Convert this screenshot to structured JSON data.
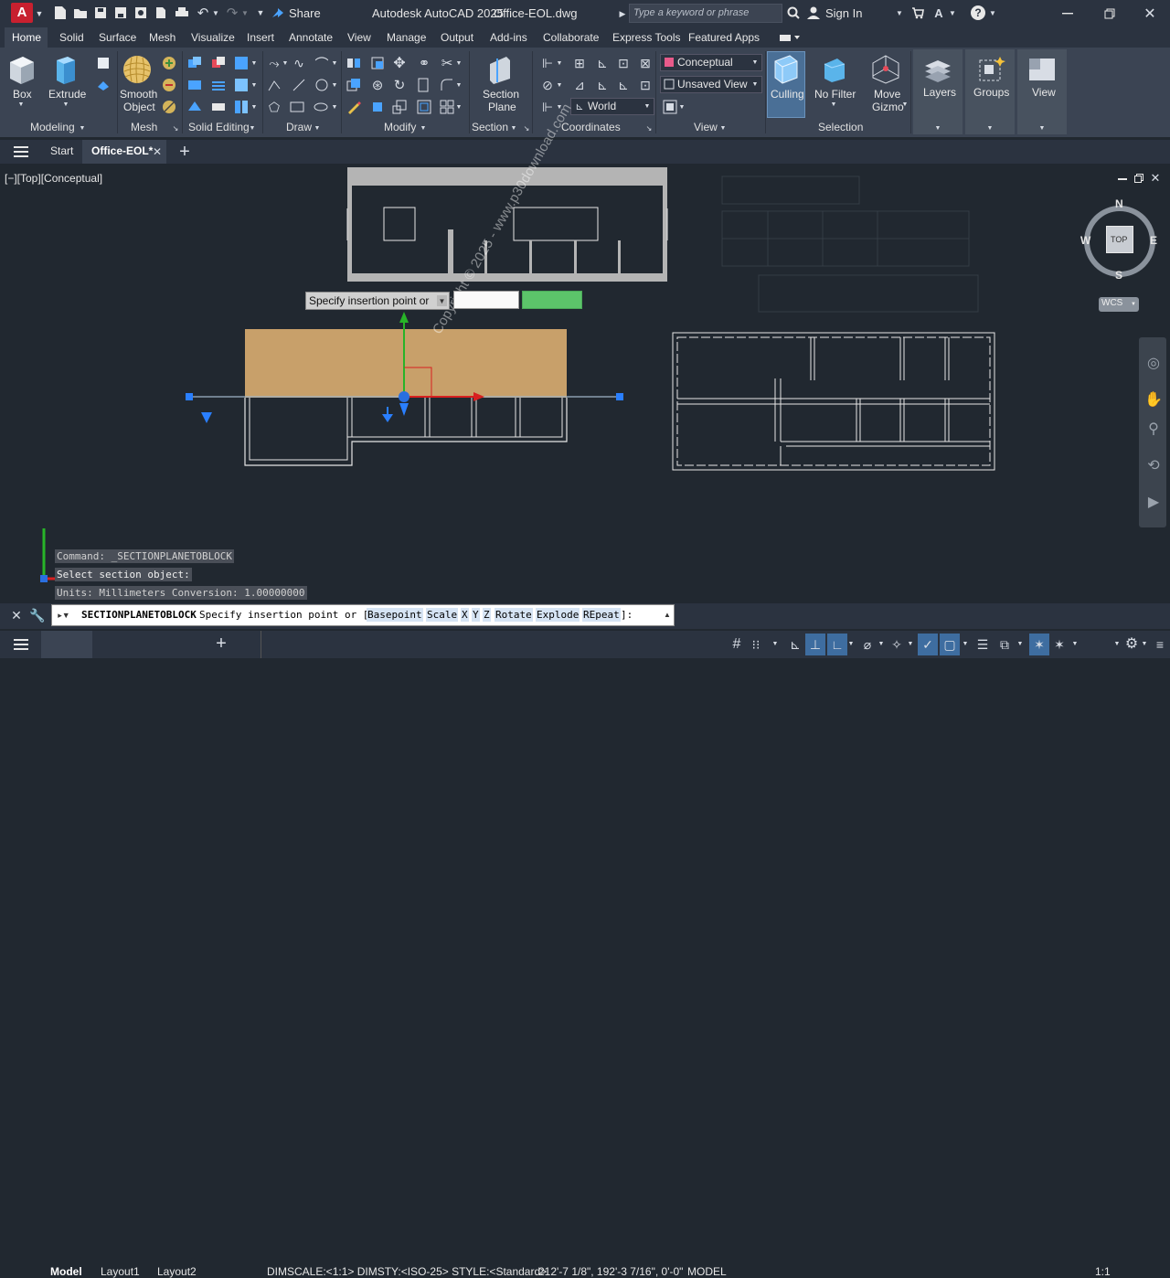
{
  "app": {
    "logo_letter": "A",
    "title": "Autodesk AutoCAD 2025",
    "filename": "Office-EOL.dwg",
    "share_label": "Share",
    "search_placeholder": "Type a keyword or phrase",
    "sign_in": "Sign In"
  },
  "ribbon_tabs": [
    "Home",
    "Solid",
    "Surface",
    "Mesh",
    "Visualize",
    "Insert",
    "Annotate",
    "View",
    "Manage",
    "Output",
    "Add-ins",
    "Collaborate",
    "Express Tools",
    "Featured Apps"
  ],
  "ribbon": {
    "box": "Box",
    "extrude": "Extrude",
    "smooth_object_1": "Smooth",
    "smooth_object_2": "Object",
    "section_plane_1": "Section",
    "section_plane_2": "Plane",
    "visual_style": "Conceptual",
    "view": "Unsaved View",
    "ucs": "World",
    "culling": "Culling",
    "no_filter": "No Filter",
    "move_gizmo_1": "Move",
    "move_gizmo_2": "Gizmo",
    "layers": "Layers",
    "groups": "Groups",
    "view_btn": "View",
    "panels": {
      "modeling": "Modeling",
      "mesh": "Mesh",
      "solid_editing": "Solid Editing",
      "draw": "Draw",
      "modify": "Modify",
      "section": "Section",
      "coordinates": "Coordinates",
      "view": "View",
      "selection": "Selection"
    }
  },
  "doc_tabs": {
    "start": "Start",
    "active": "Office-EOL*"
  },
  "viewport": {
    "label": "[−][Top][Conceptual]",
    "tooltip": "Specify insertion point or",
    "viewcube_top": "TOP",
    "compass_n": "N",
    "compass_s": "S",
    "compass_e": "E",
    "compass_w": "W",
    "wcs": "WCS",
    "watermark": "Copyright © 2025 - www.p30download.com"
  },
  "command_history": [
    "Command: _SECTIONPLANETOBLOCK",
    "Select section object:",
    "Units: Millimeters   Conversion: 1.00000000"
  ],
  "command_line": {
    "command": "SECTIONPLANETOBLOCK",
    "prompt": "Specify insertion point or [",
    "options": [
      "Basepoint",
      "Scale",
      "X",
      "Y",
      "Z",
      "Rotate",
      "Explode",
      "REpeat"
    ],
    "suffix": "]:"
  },
  "status": {
    "model_tab": "Model",
    "layout1": "Layout1",
    "layout2": "Layout2",
    "dimscale": "DIMSCALE:<1:1> DIMSTY:<ISO-25> STYLE:<Standard>",
    "coords": "212'-7 1/8\", 192'-3 7/16\", 0'-0\"",
    "model_space": "MODEL",
    "scale": "1:1"
  }
}
